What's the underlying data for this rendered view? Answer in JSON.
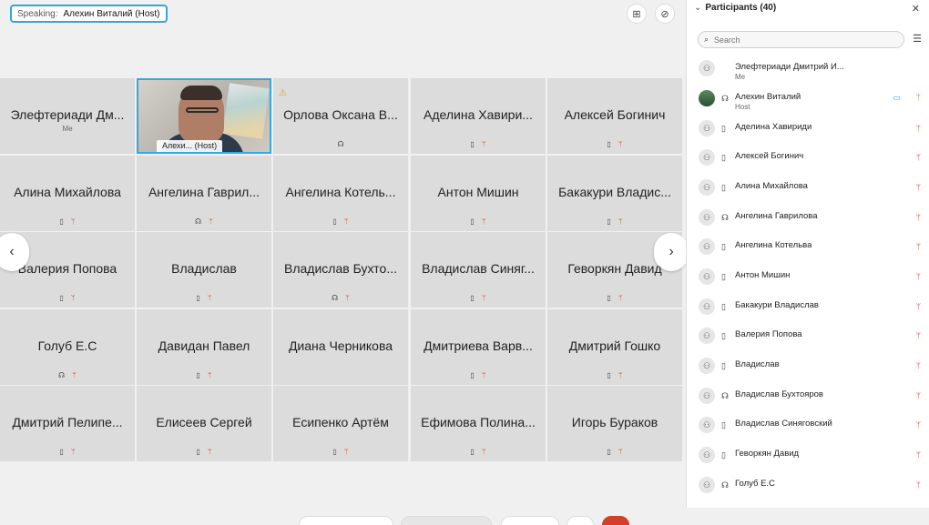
{
  "speaking": {
    "label": "Speaking:",
    "name": "Алехин Виталий (Host)"
  },
  "tiles": [
    {
      "name": "Элефтериади Дм...",
      "sub": "Me",
      "device": "",
      "muted": false
    },
    {
      "name": "",
      "host_label": "Алехи...     (Host)",
      "device": "headset",
      "muted": false,
      "host": true
    },
    {
      "name": "Орлова Оксана В...",
      "device": "headset",
      "muted": false
    },
    {
      "name": "Аделина Хавири...",
      "device": "phone",
      "muted": true
    },
    {
      "name": "Алексей Богинич",
      "device": "phone",
      "muted": true
    },
    {
      "name": "Алина Михайлова",
      "device": "phone",
      "muted": true
    },
    {
      "name": "Ангелина Гаврил...",
      "device": "headset",
      "muted": true
    },
    {
      "name": "Ангелина Котель...",
      "device": "phone",
      "muted": true
    },
    {
      "name": "Антон Мишин",
      "device": "phone",
      "muted": true
    },
    {
      "name": "Бакакури Владис...",
      "device": "phone",
      "muted": true
    },
    {
      "name": "Валерия Попова",
      "device": "phone",
      "muted": true
    },
    {
      "name": "Владислав",
      "device": "phone",
      "muted": true
    },
    {
      "name": "Владислав Бухто...",
      "device": "headset",
      "muted": true
    },
    {
      "name": "Владислав Синяг...",
      "device": "phone",
      "muted": true
    },
    {
      "name": "Геворкян Давид",
      "device": "phone",
      "muted": true
    },
    {
      "name": "Голуб Е.С",
      "device": "headset",
      "muted": true
    },
    {
      "name": "Давидан Павел",
      "device": "phone",
      "muted": true
    },
    {
      "name": "Диана Черникова",
      "device": "",
      "muted": false
    },
    {
      "name": "Дмитриева Варв...",
      "device": "phone",
      "muted": true
    },
    {
      "name": "Дмитрий Гошко",
      "device": "phone",
      "muted": true
    },
    {
      "name": "Дмитрий Пелипе...",
      "device": "phone",
      "muted": true
    },
    {
      "name": "Елисеев Сергей",
      "device": "phone",
      "muted": true
    },
    {
      "name": "Есипенко Артём",
      "device": "phone",
      "muted": true
    },
    {
      "name": "Ефимова Полина...",
      "device": "phone",
      "muted": true
    },
    {
      "name": "Игорь Бураков",
      "device": "phone",
      "muted": true
    }
  ],
  "participants_panel": {
    "title": "Participants (40)",
    "search_placeholder": "Search",
    "participants": [
      {
        "name": "Элефтериади Дмитрий И...",
        "sub": "Me",
        "device": "",
        "muted": false
      },
      {
        "name": "Алехин Виталий",
        "sub": "Host",
        "device": "headset",
        "muted": false,
        "video": true,
        "photo": true
      },
      {
        "name": "Аделина Хавириди",
        "device": "phone",
        "muted": true
      },
      {
        "name": "Алексей Богинич",
        "device": "phone",
        "muted": true
      },
      {
        "name": "Алина Михайлова",
        "device": "phone",
        "muted": true
      },
      {
        "name": "Ангелина Гаврилова",
        "device": "headset",
        "muted": true
      },
      {
        "name": "Ангелина Котельва",
        "device": "phone",
        "muted": true
      },
      {
        "name": "Антон Мишин",
        "device": "phone",
        "muted": true
      },
      {
        "name": "Бакакури Владислав",
        "device": "phone",
        "muted": true
      },
      {
        "name": "Валерия Попова",
        "device": "phone",
        "muted": true
      },
      {
        "name": "Владислав",
        "device": "phone",
        "muted": true
      },
      {
        "name": "Владислав Бухтояров",
        "device": "headset",
        "muted": true
      },
      {
        "name": "Владислав Синяговский",
        "device": "phone",
        "muted": true
      },
      {
        "name": "Геворкян Давид",
        "device": "phone",
        "muted": true
      },
      {
        "name": "Голуб Е.С",
        "device": "headset",
        "muted": true
      }
    ]
  },
  "icons": {
    "phone": "▯",
    "headset": "☊",
    "muted": "ᛘ",
    "person": "⚇",
    "video": "▭",
    "mic": "ᛘ",
    "grid": "⊞",
    "layout": "⊘",
    "search": "⌕",
    "sort": "☰",
    "close": "✕",
    "chevron_down": "⌄",
    "prev": "‹",
    "next": "›",
    "warning": "⚠"
  },
  "colors": {
    "accent": "#38a3d8",
    "muted": "#e0452e",
    "mic_on": "#3bb24a",
    "tile_bg": "#dcdcdc"
  }
}
